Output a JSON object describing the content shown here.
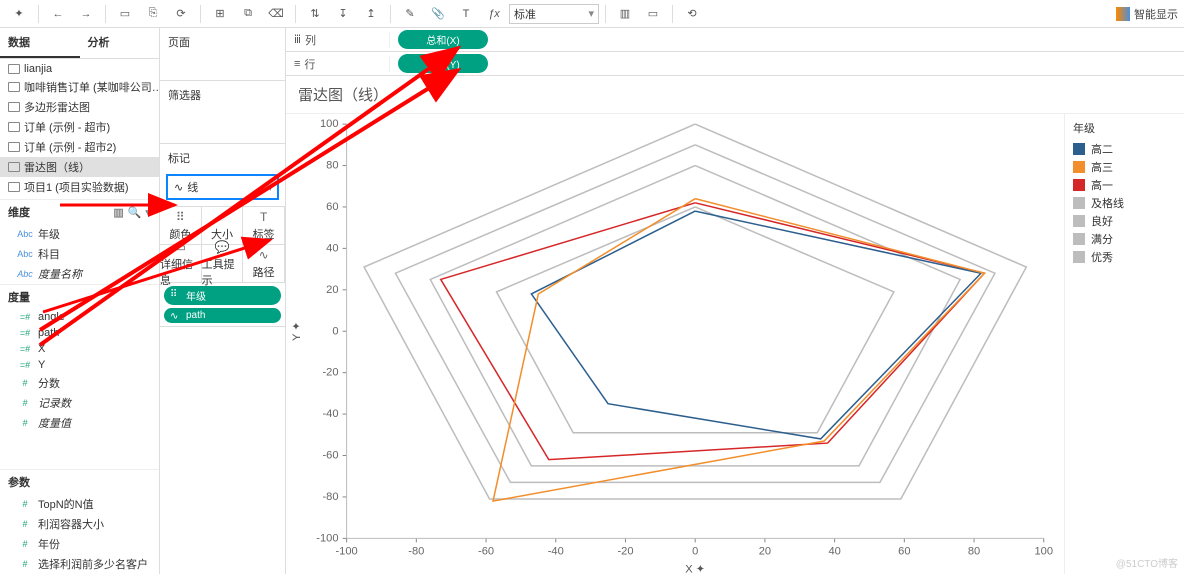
{
  "toolbar": {
    "std_label": "标准",
    "smart": "智能显示"
  },
  "side": {
    "tab_data": "数据",
    "tab_analysis": "分析",
    "datasources": [
      {
        "label": "lianjia"
      },
      {
        "label": "咖啡销售订单 (某咖啡公司…"
      },
      {
        "label": "多边形雷达图"
      },
      {
        "label": "订单 (示例 - 超市)"
      },
      {
        "label": "订单 (示例 - 超市2)"
      },
      {
        "label": "雷达图（线）",
        "active": true
      },
      {
        "label": "项目1 (项目实验数据)"
      }
    ],
    "dims_head": "维度",
    "dims": [
      {
        "type": "Abc",
        "label": "年级"
      },
      {
        "type": "Abc",
        "label": "科目"
      },
      {
        "type": "Abc",
        "label": "度量名称",
        "calc": true
      }
    ],
    "meas_head": "度量",
    "meas": [
      {
        "type": "=#",
        "label": "angle"
      },
      {
        "type": "=#",
        "label": "path"
      },
      {
        "type": "=#",
        "label": "X"
      },
      {
        "type": "=#",
        "label": "Y"
      },
      {
        "type": "#",
        "label": "分数"
      },
      {
        "type": "#",
        "label": "记录数",
        "calc": true
      },
      {
        "type": "#",
        "label": "度量值",
        "calc": true
      }
    ],
    "params_head": "参数",
    "params": [
      {
        "type": "#",
        "label": "TopN的N值"
      },
      {
        "type": "#",
        "label": "利润容器大小"
      },
      {
        "type": "#",
        "label": "年份"
      },
      {
        "type": "#",
        "label": "选择利润前多少名客户"
      }
    ]
  },
  "shelves": {
    "pages": "页面",
    "filters": "筛选器",
    "marks": "标记",
    "marktype": "线",
    "grid": [
      "颜色",
      "大小",
      "标签",
      "详细信息",
      "工具提示",
      "路径"
    ],
    "pills": [
      {
        "icon": "⠿",
        "label": "年级"
      },
      {
        "icon": "∿",
        "label": "path"
      }
    ]
  },
  "rowcol": {
    "col_lab": "列",
    "col_pill": "总和(X)",
    "row_lab": "行",
    "row_pill": "总和(Y)"
  },
  "title": "雷达图（线）",
  "axes": {
    "xlab": "X",
    "ylab": "Y"
  },
  "legend": {
    "title": "年级",
    "items": [
      {
        "label": "高二",
        "color": "#2c5f8d"
      },
      {
        "label": "高三",
        "color": "#f28e2b"
      },
      {
        "label": "高一",
        "color": "#d62728"
      },
      {
        "label": "及格线",
        "color": "#bdbdbd"
      },
      {
        "label": "良好",
        "color": "#bdbdbd"
      },
      {
        "label": "满分",
        "color": "#bdbdbd"
      },
      {
        "label": "优秀",
        "color": "#bdbdbd"
      }
    ]
  },
  "chart_data": {
    "type": "line",
    "xlabel": "X",
    "ylabel": "Y",
    "xlim": [
      -100,
      100
    ],
    "ylim": [
      -100,
      100
    ],
    "xticks": [
      -100,
      -80,
      -60,
      -40,
      -20,
      0,
      20,
      40,
      60,
      80,
      100
    ],
    "yticks": [
      -100,
      -80,
      -60,
      -40,
      -20,
      0,
      20,
      40,
      60,
      80,
      100
    ],
    "series": [
      {
        "name": "满分",
        "color": "#bdbdbd",
        "points": [
          [
            0,
            100
          ],
          [
            95,
            31
          ],
          [
            59,
            -81
          ],
          [
            -59,
            -81
          ],
          [
            -95,
            31
          ],
          [
            0,
            100
          ]
        ]
      },
      {
        "name": "优秀",
        "color": "#bdbdbd",
        "points": [
          [
            0,
            90
          ],
          [
            86,
            28
          ],
          [
            53,
            -73
          ],
          [
            -53,
            -73
          ],
          [
            -86,
            28
          ],
          [
            0,
            90
          ]
        ]
      },
      {
        "name": "良好",
        "color": "#bdbdbd",
        "points": [
          [
            0,
            80
          ],
          [
            76,
            25
          ],
          [
            47,
            -65
          ],
          [
            -47,
            -65
          ],
          [
            -76,
            25
          ],
          [
            0,
            80
          ]
        ]
      },
      {
        "name": "及格线",
        "color": "#bdbdbd",
        "points": [
          [
            0,
            60
          ],
          [
            57,
            19
          ],
          [
            35,
            -49
          ],
          [
            -35,
            -49
          ],
          [
            -57,
            19
          ],
          [
            0,
            60
          ]
        ]
      },
      {
        "name": "高一",
        "color": "#d62728",
        "points": [
          [
            0,
            62
          ],
          [
            83,
            28
          ],
          [
            38,
            -54
          ],
          [
            -42,
            -62
          ],
          [
            -73,
            25
          ],
          [
            0,
            62
          ]
        ]
      },
      {
        "name": "高二",
        "color": "#2c5f8d",
        "points": [
          [
            0,
            58
          ],
          [
            82,
            28
          ],
          [
            36,
            -52
          ],
          [
            -25,
            -35
          ],
          [
            -47,
            18
          ],
          [
            0,
            58
          ]
        ]
      },
      {
        "name": "高三",
        "color": "#f28e2b",
        "points": [
          [
            0,
            64
          ],
          [
            83,
            28
          ],
          [
            37,
            -53
          ],
          [
            -58,
            -82
          ],
          [
            -45,
            18
          ],
          [
            0,
            64
          ]
        ]
      }
    ]
  },
  "watermark": "@51CTO博客"
}
